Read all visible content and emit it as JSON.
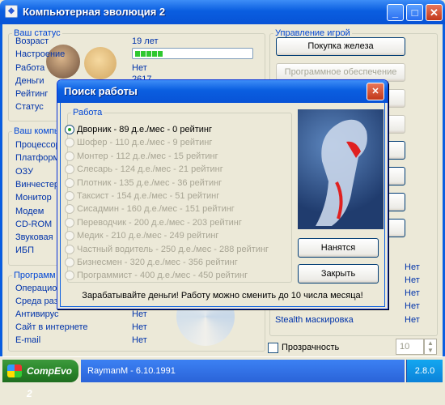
{
  "app": {
    "title": "Компьютерная эволюция 2"
  },
  "window_buttons": {
    "minimize": "_",
    "maximize": "□",
    "close": "✕"
  },
  "status": {
    "legend": "Ваш статус",
    "age_label": "Возраст",
    "age_value": "19 лет",
    "mood_label": "Настроение",
    "mood_level": 0.25,
    "work_label": "Работа",
    "work_value": "Нет",
    "money_label": "Деньги",
    "money_value": "2617",
    "rating_label": "Рейтинг",
    "status_label": "Статус"
  },
  "computer": {
    "legend": "Ваш компь",
    "items": [
      "Процессор",
      "Платформ",
      "ОЗУ",
      "Винчестер",
      "Монитор",
      "Модем",
      "CD-ROM",
      "Звуковая",
      "ИБП"
    ]
  },
  "programs": {
    "legend": "Программ",
    "items": [
      {
        "label": "Операцион",
        "value": ""
      },
      {
        "label": "Среда раз",
        "value": ""
      },
      {
        "label": "Антивирус",
        "value": "Нет"
      },
      {
        "label": "Сайт в интернете",
        "value": "Нет"
      },
      {
        "label": "E-mail",
        "value": "Нет"
      }
    ]
  },
  "game": {
    "legend": "Управление игрой",
    "buttons": [
      {
        "label": "Покупка железа",
        "enabled": true
      },
      {
        "label": "Программное обеспечение",
        "enabled": false
      },
      {
        "label": "за",
        "enabled": false
      },
      {
        "label": "ом",
        "enabled": false
      },
      {
        "label": "",
        "enabled": true
      },
      {
        "label": "ия",
        "enabled": true
      },
      {
        "label": "",
        "enabled": true
      },
      {
        "label": "",
        "enabled": true
      }
    ],
    "right_values": [
      "Нет",
      "Нет",
      "Нет",
      "Нет"
    ],
    "firewall_label": "Antifirewall",
    "stealth_label": "Stealth маскировка",
    "stealth_value": "Нет",
    "transparency_label": "Прозрачность",
    "transparency_value": "10"
  },
  "dialog": {
    "title": "Поиск работы",
    "close": "✕",
    "group_label": "Работа",
    "jobs": [
      {
        "label": "Дворник - 89 д.е./мес - 0 рейтинг",
        "selected": true
      },
      {
        "label": "Шофер - 110 д.е./мес - 9 рейтинг",
        "selected": false
      },
      {
        "label": "Монтер - 112 д.е./мес - 15 рейтинг",
        "selected": false
      },
      {
        "label": "Слесарь - 124 д.е./мес - 21 рейтинг",
        "selected": false
      },
      {
        "label": "Плотник - 135 д.е./мес - 36 рейтинг",
        "selected": false
      },
      {
        "label": "Таксист - 154 д.е./мес - 51 рейтинг",
        "selected": false
      },
      {
        "label": "Сисадмин - 160 д.е./мес - 151 рейтинг",
        "selected": false
      },
      {
        "label": "Переводчик - 200 д.е./мес - 203 рейтинг",
        "selected": false
      },
      {
        "label": "Медик - 210 д.е./мес - 249 рейтинг",
        "selected": false
      },
      {
        "label": "Частный водитель - 250 д.е./мес - 288 рейтинг",
        "selected": false
      },
      {
        "label": "Бизнесмен - 320 д.е./мес - 356 рейтинг",
        "selected": false
      },
      {
        "label": "Программист - 400 д.е./мес - 450 рейтинг",
        "selected": false
      }
    ],
    "hire_button": "Нанятся",
    "close_button": "Закрыть",
    "footer": "Зарабатывайте деньги! Работу можно сменить до 10 числа месяца!"
  },
  "taskbar": {
    "start_label": "CompEvo 2",
    "info": "RaymanM - 6.10.1991",
    "version": "2.8.0"
  },
  "colors": {
    "accent": "#0a5ee0",
    "label": "#0033aa",
    "mood": "#2fc82f"
  }
}
